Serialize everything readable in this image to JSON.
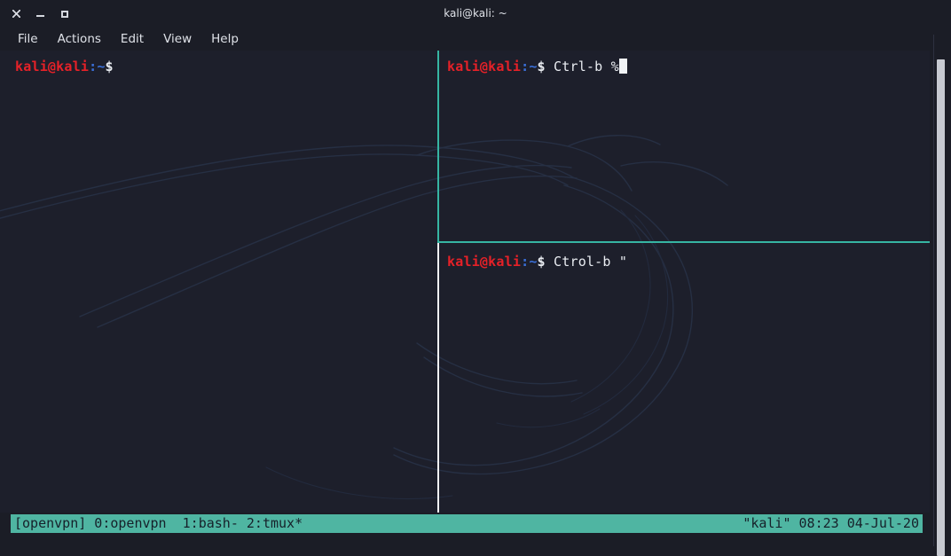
{
  "window": {
    "title": "kali@kali: ~",
    "controls": [
      {
        "name": "close",
        "glyph": "✕"
      },
      {
        "name": "minimize",
        "glyph": "–"
      },
      {
        "name": "maximize",
        "glyph": "□"
      }
    ]
  },
  "menubar": {
    "items": [
      {
        "label": "File"
      },
      {
        "label": "Actions"
      },
      {
        "label": "Edit"
      },
      {
        "label": "View"
      },
      {
        "label": "Help"
      }
    ]
  },
  "prompt": {
    "user_host": "kali@kali",
    "colon": ":",
    "path": "~",
    "sigil": "$"
  },
  "panes": {
    "left": {
      "command": ""
    },
    "top_right": {
      "command": " Ctrl-b %"
    },
    "bottom_right": {
      "command": " Ctrol-b \""
    }
  },
  "statusbar": {
    "left": "[openvpn] 0:openvpn  1:bash- 2:tmux*",
    "right": "\"kali\" 08:23 04-Jul-20",
    "session": "openvpn",
    "windows": [
      {
        "index": "0",
        "name": "openvpn",
        "flag": ""
      },
      {
        "index": "1",
        "name": "bash",
        "flag": "-"
      },
      {
        "index": "2",
        "name": "tmux",
        "flag": "*"
      }
    ],
    "hostname": "kali",
    "time": "08:23",
    "date": "04-Jul-20"
  },
  "colors": {
    "background": "#1d1f2b",
    "chrome": "#1b1d26",
    "prompt_user": "#e62128",
    "prompt_path": "#3a6fd8",
    "foreground": "#e9ecf1",
    "active_border": "#36b5a3",
    "inactive_border": "#f0f2f5",
    "status_bg": "#4fb5a2",
    "status_fg": "#16202a"
  }
}
